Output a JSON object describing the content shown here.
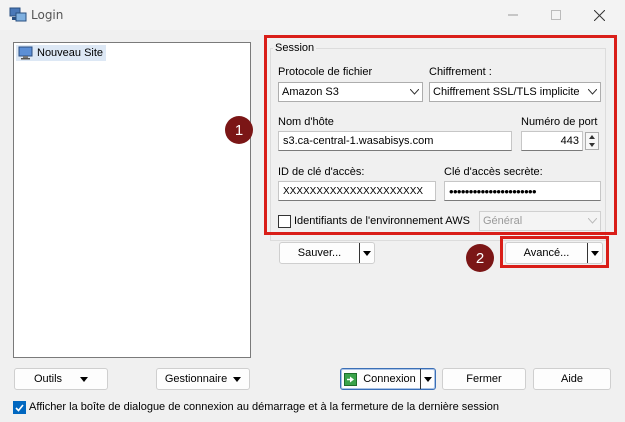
{
  "window": {
    "title": "Login"
  },
  "sites": [
    {
      "label": "Nouveau Site"
    }
  ],
  "session": {
    "group_title": "Session",
    "protocol": {
      "label": "Protocole de fichier",
      "value": "Amazon S3"
    },
    "encryption": {
      "label": "Chiffrement :",
      "value": "Chiffrement SSL/TLS implicite"
    },
    "host": {
      "label": "Nom d'hôte",
      "value": "s3.ca-central-1.wasabisys.com"
    },
    "port": {
      "label": "Numéro de port",
      "value": "443"
    },
    "access_key": {
      "label": "ID de clé d'accès:",
      "value": "XXXXXXXXXXXXXXXXXXXXX"
    },
    "secret_key": {
      "label": "Clé d'accès secrète:",
      "value": "••••••••••••••••••••••"
    },
    "env_credentials": {
      "label": "Identifiants de l'environnement AWS",
      "checked": false
    },
    "env_profile": {
      "value": "Général"
    }
  },
  "buttons": {
    "save": "Sauver...",
    "advanced": "Avancé...",
    "tools": "Outils",
    "manager": "Gestionnaire",
    "connect": "Connexion",
    "close": "Fermer",
    "help": "Aide"
  },
  "footer": {
    "show_dialog_label": "Afficher la boîte de dialogue de connexion au démarrage et à la fermeture de la dernière session",
    "show_dialog_checked": true
  },
  "annotations": {
    "marker1": "1",
    "marker2": "2"
  },
  "colors": {
    "highlight_red": "#d91e18",
    "marker_fill": "#7b1616",
    "checkbox_blue": "#0067c0"
  }
}
